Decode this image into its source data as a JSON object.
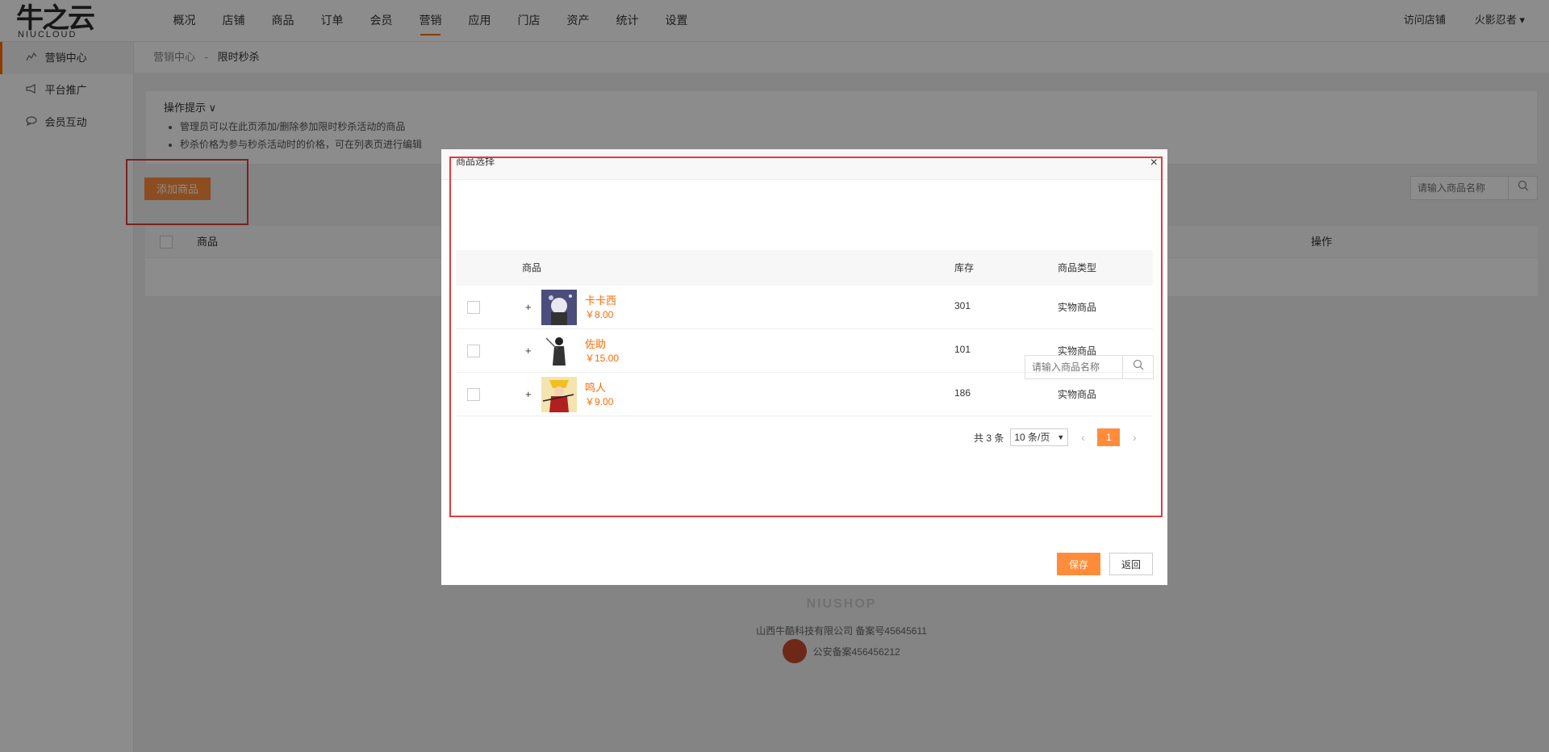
{
  "brand": {
    "logo_main": "牛之云",
    "logo_sub": "NIUCLOUD"
  },
  "nav": {
    "items": [
      {
        "label": "概况"
      },
      {
        "label": "店铺"
      },
      {
        "label": "商品"
      },
      {
        "label": "订单"
      },
      {
        "label": "会员"
      },
      {
        "label": "营销"
      },
      {
        "label": "应用"
      },
      {
        "label": "门店"
      },
      {
        "label": "资产"
      },
      {
        "label": "统计"
      },
      {
        "label": "设置"
      }
    ],
    "active": "营销",
    "visit_store": "访问店铺",
    "user": "火影忍者 ▾"
  },
  "sidebar": {
    "items": [
      {
        "label": "营销中心",
        "icon": "chart-icon"
      },
      {
        "label": "平台推广",
        "icon": "megaphone-icon"
      },
      {
        "label": "会员互动",
        "icon": "chat-icon"
      }
    ]
  },
  "breadcrumb": {
    "parent": "营销中心",
    "sep": "-",
    "current": "限时秒杀"
  },
  "tips": {
    "title": "操作提示 ∨",
    "lines": [
      "管理员可以在此页添加/删除参加限时秒杀活动的商品",
      "秒杀价格为参与秒杀活动时的价格，可在列表页进行编辑"
    ]
  },
  "main": {
    "add_button": "添加商品",
    "search_placeholder": "请输入商品名称",
    "col_goods": "商品",
    "col_action": "操作"
  },
  "footer": {
    "brand": "NIUSHOP",
    "company": "山西牛酷科技有限公司  备案号45645611",
    "police": "公安备案456456212"
  },
  "modal": {
    "title": "商品选择",
    "close": "×",
    "search_placeholder": "请输入商品名称",
    "headers": {
      "goods": "商品",
      "stock": "库存",
      "type": "商品类型"
    },
    "rows": [
      {
        "name": "卡卡西",
        "price": "￥8.00",
        "stock": "301",
        "type": "实物商品"
      },
      {
        "name": "佐助",
        "price": "￥15.00",
        "stock": "101",
        "type": "实物商品"
      },
      {
        "name": "鸣人",
        "price": "￥9.00",
        "stock": "186",
        "type": "实物商品"
      }
    ],
    "pager": {
      "total": "共 3 条",
      "per_page": "10 条/页",
      "prev": "‹",
      "page": "1",
      "next": "›"
    },
    "save": "保存",
    "back": "返回"
  },
  "colors": {
    "accent": "#ff8c3b",
    "active_nav": "#ff6a00",
    "highlight_border": "#e23b3b"
  }
}
